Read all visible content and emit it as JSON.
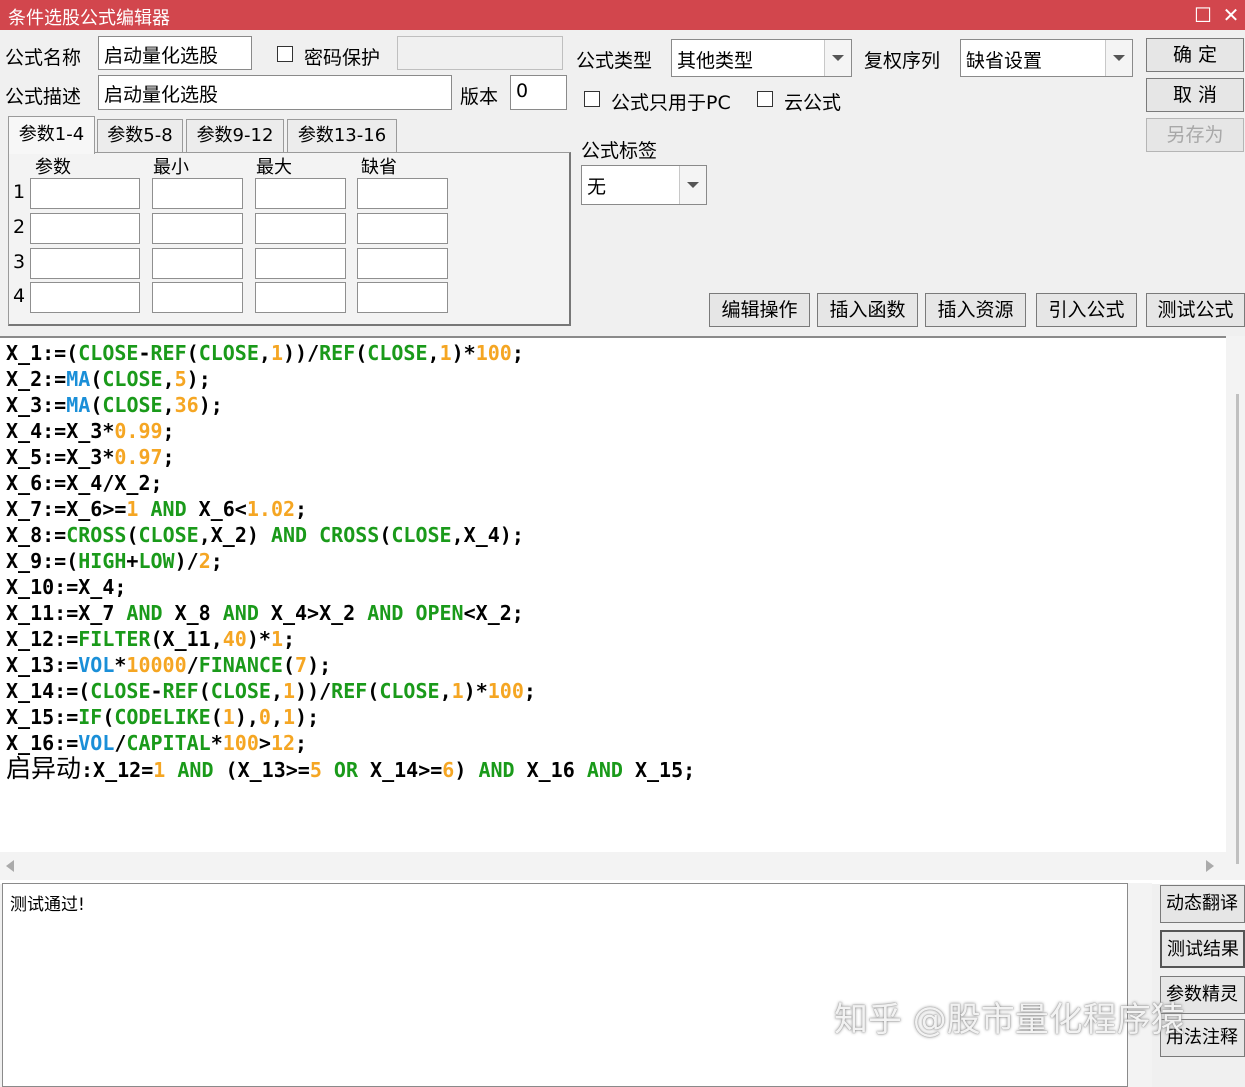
{
  "window": {
    "title": "条件选股公式编辑器",
    "maximize_glyph": "☐",
    "close_glyph": "✕"
  },
  "form": {
    "name_label": "公式名称",
    "name_value": "启动量化选股",
    "password_label": "密码保护",
    "password_checked": false,
    "desc_label": "公式描述",
    "desc_value": "启动量化选股",
    "version_label": "版本",
    "version_value": "0",
    "type_label": "公式类型",
    "type_value": "其他类型",
    "rights_label": "复权序列",
    "rights_value": "缺省设置",
    "pc_only_label": "公式只用于PC",
    "pc_only_checked": false,
    "cloud_label": "云公式",
    "cloud_checked": false,
    "tag_label": "公式标签",
    "tag_value": "无"
  },
  "buttons": {
    "ok": "确  定",
    "cancel": "取  消",
    "save_as": "另存为",
    "edit_ops": "编辑操作",
    "insert_func": "插入函数",
    "insert_res": "插入资源",
    "import_formula": "引入公式",
    "test_formula": "测试公式"
  },
  "tabs": [
    "参数1-4",
    "参数5-8",
    "参数9-12",
    "参数13-16"
  ],
  "params": {
    "headers": [
      "参数",
      "最小",
      "最大",
      "缺省"
    ],
    "rows": [
      "1",
      "2",
      "3",
      "4"
    ]
  },
  "code": [
    "X_1:=(CLOSE-REF(CLOSE,1))/REF(CLOSE,1)*100;",
    "X_2:=MA(CLOSE,5);",
    "X_3:=MA(CLOSE,36);",
    "X_4:=X_3*0.99;",
    "X_5:=X_3*0.97;",
    "X_6:=X_4/X_2;",
    "X_7:=X_6>=1 AND X_6<1.02;",
    "X_8:=CROSS(CLOSE,X_2) AND CROSS(CLOSE,X_4);",
    "X_9:=(HIGH+LOW)/2;",
    "X_10:=X_4;",
    "X_11:=X_7 AND X_8 AND X_4>X_2 AND OPEN<X_2;",
    "X_12:=FILTER(X_11,40)*1;",
    "X_13:=VOL*10000/FINANCE(7);",
    "X_14:=(CLOSE-REF(CLOSE,1))/REF(CLOSE,1)*100;",
    "X_15:=IF(CODELIKE(1),0,1);",
    "X_16:=VOL/CAPITAL*100>12;",
    "启异动:X_12=1 AND (X_13>=5 OR X_14>=6) AND X_16 AND X_15;"
  ],
  "code_colors": {
    "function": "#1a9a1a",
    "number": "#f5a623",
    "builtin": "#1a8fd8"
  },
  "message": "测试通过!",
  "side_buttons": [
    "动态翻译",
    "测试结果",
    "参数精灵",
    "用法注释"
  ],
  "watermark": "知乎 @股市量化程序猿"
}
